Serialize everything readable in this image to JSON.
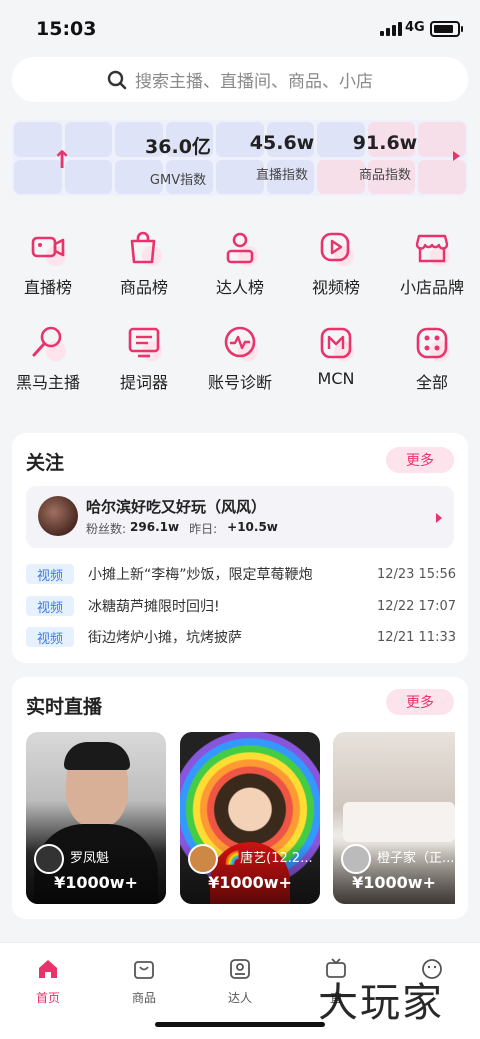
{
  "status": {
    "time": "15:03",
    "network": "4G"
  },
  "search": {
    "placeholder": "搜索主播、直播间、商品、小店"
  },
  "stats": [
    {
      "value": "36.0亿",
      "label": "GMV指数"
    },
    {
      "value": "45.6w",
      "label": "直播指数"
    },
    {
      "value": "91.6w",
      "label": "商品指数"
    }
  ],
  "shortcuts": [
    {
      "label": "直播榜",
      "icon": "camera-icon"
    },
    {
      "label": "商品榜",
      "icon": "shopping-bag-icon"
    },
    {
      "label": "达人榜",
      "icon": "person-icon"
    },
    {
      "label": "视频榜",
      "icon": "play-icon"
    },
    {
      "label": "小店品牌",
      "icon": "store-icon"
    },
    {
      "label": "黑马主播",
      "icon": "magnifier-icon"
    },
    {
      "label": "提词器",
      "icon": "prompter-icon"
    },
    {
      "label": "账号诊断",
      "icon": "pulse-icon"
    },
    {
      "label": "MCN",
      "icon": "mcn-icon"
    },
    {
      "label": "全部",
      "icon": "grid-icon"
    }
  ],
  "follow": {
    "title": "关注",
    "more": "更多",
    "account": {
      "name": "哈尔滨好吃又好玩（风风）",
      "fans_label": "粉丝数:",
      "fans": "296.1w",
      "yesterday_label": "昨日:",
      "yesterday": "+10.5w"
    },
    "news": [
      {
        "tag": "视频",
        "text": "小摊上新“李梅”炒饭，限定草莓鞭炮",
        "date": "12/23 15:56"
      },
      {
        "tag": "视频",
        "text": "冰糖葫芦摊限时回归!",
        "date": "12/22 17:07"
      },
      {
        "tag": "视频",
        "text": "街边烤炉小摊，坑烤披萨",
        "date": "12/21 11:33"
      }
    ]
  },
  "live": {
    "title": "实时直播",
    "more": "更多",
    "items": [
      {
        "name": "罗凤魁",
        "value": "¥1000w+"
      },
      {
        "name": "🌈唐艺(12.2...",
        "value": "¥1000w+"
      },
      {
        "name": "橙子家（正...",
        "value": "¥1000w+"
      }
    ]
  },
  "tabs": [
    {
      "label": "首页",
      "icon": "home-icon",
      "active": true
    },
    {
      "label": "商品",
      "icon": "bag-icon"
    },
    {
      "label": "达人",
      "icon": "user-card-icon"
    },
    {
      "label": "直",
      "icon": "tv-icon"
    },
    {
      "label": "",
      "icon": "smile-icon"
    }
  ],
  "watermark": "大玩家",
  "colors": {
    "accent": "#e8336b",
    "tag_blue": "#3a7be6",
    "bg": "#f4f5f7"
  }
}
